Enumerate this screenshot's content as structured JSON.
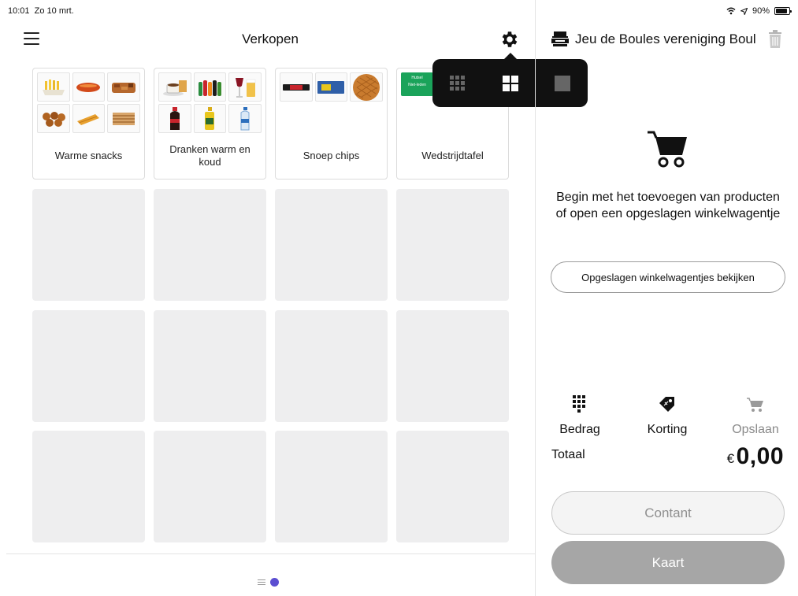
{
  "status_bar": {
    "time": "10:01",
    "date": "Zo 10 mrt.",
    "battery": "90%",
    "battery_level": 0.9
  },
  "header": {
    "title": "Verkopen"
  },
  "categories": [
    {
      "label": "Warme snacks"
    },
    {
      "label": "Dranken warm en koud"
    },
    {
      "label": "Snoep chips"
    },
    {
      "label": "Wedstrijdtafel"
    }
  ],
  "wedstrijd_tags": [
    "Hutsel",
    "Niet-leden"
  ],
  "layout_options": [
    "grid-small",
    "grid-medium",
    "grid-large"
  ],
  "register": {
    "name": "Jeu de Boules vereniging Boul"
  },
  "cart": {
    "empty_message": "Begin met het toevoegen van producten of open een opgeslagen winkelwagentje"
  },
  "saved_carts_button": "Opgeslagen winkelwagentjes bekijken",
  "actions": {
    "amount": "Bedrag",
    "discount": "Korting",
    "save": "Opslaan"
  },
  "totals": {
    "label": "Totaal",
    "currency": "€",
    "amount": "0,00"
  },
  "payment": {
    "cash": "Contant",
    "card": "Kaart"
  },
  "colors": {
    "accent": "#5b4ed1",
    "tag_green": "#1aa35a",
    "disabled": "#a6a6a6"
  }
}
